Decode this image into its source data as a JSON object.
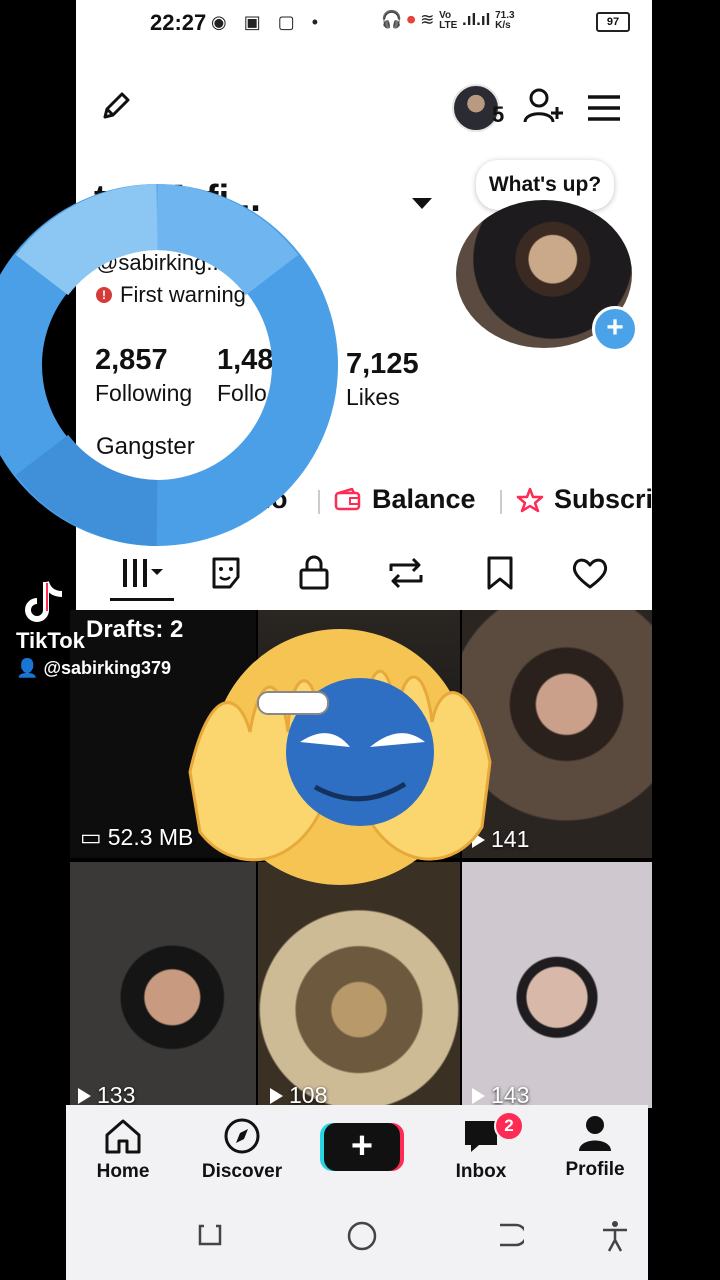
{
  "status": {
    "time": "22:27",
    "net_label_top": "Vo",
    "net_label_bottom": "LTE",
    "speed_value": "71.3",
    "speed_unit": "K/s",
    "battery": "97"
  },
  "header": {
    "follow_count_badge": "5"
  },
  "profile": {
    "name": "ter Mafi...",
    "speech_bubble": "What's up?",
    "username": "@sabirking..",
    "warning": "First warning",
    "stats": [
      {
        "value": "2,857",
        "label": "Following"
      },
      {
        "value": "1,48",
        "label": "Follo"
      },
      {
        "value": "7,125",
        "label": "Likes"
      }
    ],
    "bio": "Gangster",
    "links": {
      "studio": "lio",
      "balance": "Balance",
      "subscription": "Subscri"
    }
  },
  "grid": {
    "drafts_label": "Drafts: 2",
    "tiles": [
      {
        "label": "52.3 MB"
      },
      {
        "label": ""
      },
      {
        "label": "141"
      },
      {
        "label": "133"
      },
      {
        "label": "108"
      },
      {
        "label": "143"
      }
    ]
  },
  "watermark": {
    "brand": "TikTok",
    "user": "@sabirking379"
  },
  "nav": {
    "home": "Home",
    "discover": "Discover",
    "create": "+",
    "inbox": "Inbox",
    "inbox_badge": "2",
    "profile": "Profile"
  },
  "colors": {
    "ring_blue": "#4a9fe6",
    "create_cyan": "#2ad4e3",
    "create_red": "#fe2c55",
    "plus_blue": "#4aa3e8"
  }
}
